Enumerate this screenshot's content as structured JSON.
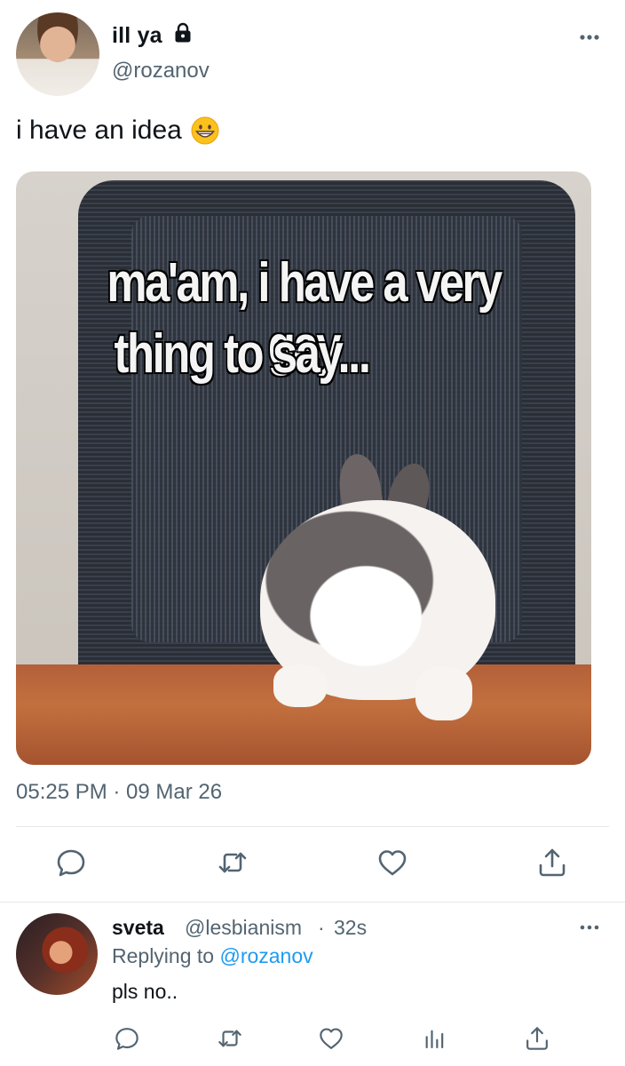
{
  "tweet": {
    "author": {
      "display_name": "ill ya",
      "handle": "@rozanov",
      "locked_icon": "lock-icon"
    },
    "text": "i have an idea",
    "emoji": "grinning-face-emoji",
    "media": {
      "caption_line1": "ma'am, i have a very gay",
      "caption_line2": "thing to say..."
    },
    "timestamp": "05:25 PM · 09 Mar 26",
    "actions": [
      "reply-icon",
      "retweet-icon",
      "like-icon",
      "share-icon"
    ]
  },
  "reply": {
    "author": {
      "display_name": "sveta",
      "handle": "@lesbianism",
      "time": "32s"
    },
    "separator": "·",
    "replying_prefix": "Replying to",
    "replying_to": "@rozanov",
    "text": "pls no..",
    "actions": [
      "reply-icon",
      "retweet-icon",
      "like-icon",
      "analytics-icon",
      "share-icon"
    ]
  },
  "colors": {
    "primary_text": "#0f1419",
    "secondary_text": "#536471",
    "accent": "#1d9bf0",
    "divider": "#e6e8ea"
  }
}
